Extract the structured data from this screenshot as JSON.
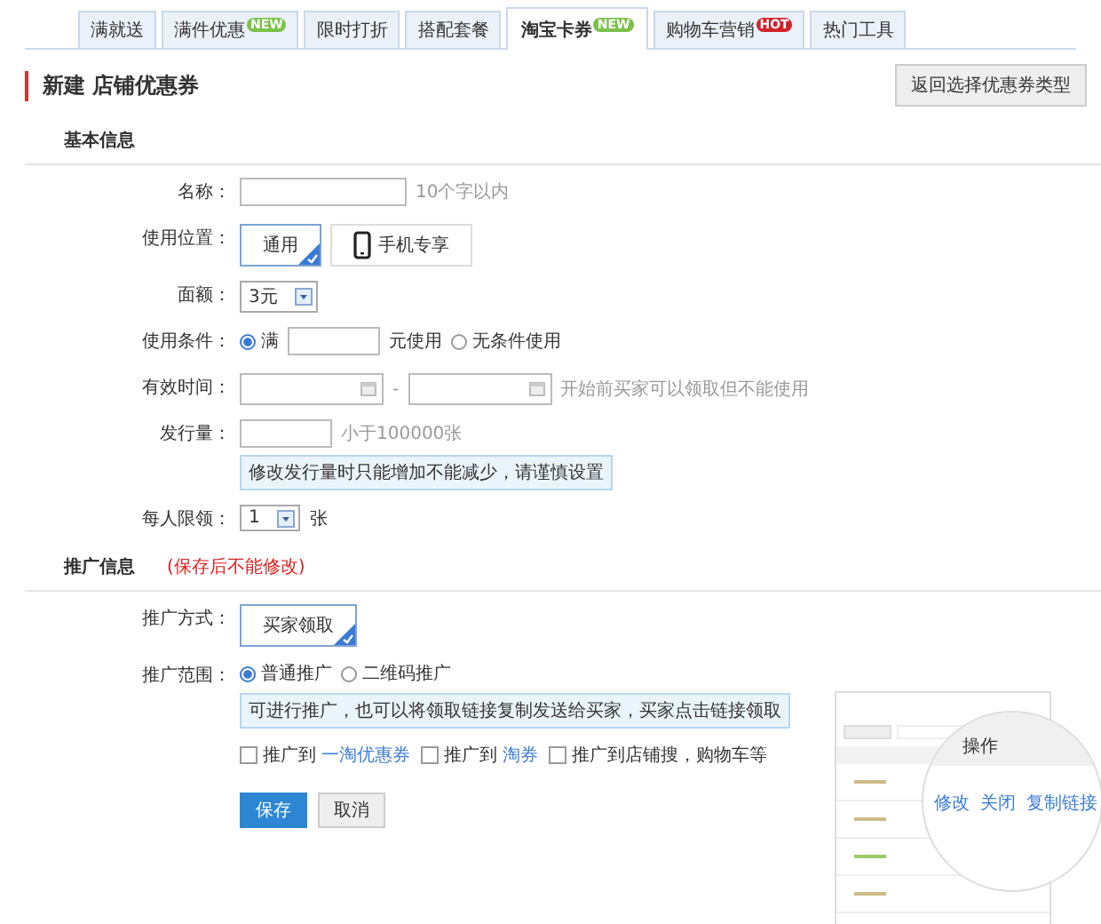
{
  "tabs": [
    {
      "label": "满就送",
      "selected": false
    },
    {
      "label": "满件优惠",
      "selected": false,
      "badge": {
        "text": "NEW",
        "kind": "new"
      }
    },
    {
      "label": "限时打折",
      "selected": false
    },
    {
      "label": "搭配套餐",
      "selected": false
    },
    {
      "label": "淘宝卡券",
      "selected": true,
      "badge": {
        "text": "NEW",
        "kind": "new"
      }
    },
    {
      "label": "购物车营销",
      "selected": false,
      "badge": {
        "text": "HOT",
        "kind": "hot"
      }
    },
    {
      "label": "热门工具",
      "selected": false
    }
  ],
  "page_title": "新建 店铺优惠券",
  "back_button": "返回选择优惠券类型",
  "basic_section": {
    "title": "基本信息",
    "rows": [
      {
        "kind": "text",
        "label": "名称：",
        "hint": "10个字以内"
      },
      {
        "kind": "choices",
        "label": "使用位置：",
        "options": [
          {
            "label": "通用",
            "selected": true,
            "kind": "plain"
          },
          {
            "label": "手机专享",
            "selected": false,
            "kind": "mobile"
          }
        ]
      },
      {
        "kind": "select",
        "label": "面额：",
        "value": "3元"
      },
      {
        "kind": "condition",
        "label": "使用条件：",
        "options": [
          {
            "label": "满",
            "selected": true
          },
          {
            "label": "无条件使用",
            "selected": false
          }
        ],
        "suffix": "元使用"
      },
      {
        "kind": "daterange",
        "label": "有效时间：",
        "separator": "-",
        "hint": "开始前买家可以领取但不能使用"
      },
      {
        "kind": "text",
        "label": "发行量：",
        "hint": "小于100000张",
        "note": "修改发行量时只能增加不能减少，请谨慎设置"
      },
      {
        "kind": "select",
        "label": "每人限领：",
        "value": "1",
        "suffix": "张"
      }
    ]
  },
  "promo_section": {
    "title": "推广信息",
    "warning": "(保存后不能修改)",
    "rows": [
      {
        "kind": "choices",
        "label": "推广方式：",
        "options": [
          {
            "label": "买家领取",
            "selected": true
          }
        ]
      },
      {
        "kind": "radios",
        "label": "推广范围：",
        "options": [
          {
            "label": "普通推广",
            "selected": true
          },
          {
            "label": "二维码推广",
            "selected": false
          }
        ],
        "note": "可进行推广，也可以将领取链接复制发送给买家，买家点击链接领取"
      },
      {
        "kind": "checks",
        "options": [
          {
            "label": "推广到",
            "link": "一淘优惠券",
            "checked": false
          },
          {
            "label": "推广到",
            "link": "淘券",
            "checked": false
          },
          {
            "label": "推广到店铺搜，购物车等",
            "checked": false
          }
        ]
      }
    ]
  },
  "buttons": [
    {
      "label": "保存",
      "kind": "primary"
    },
    {
      "label": "取消",
      "kind": "default"
    }
  ],
  "preview": {
    "header": "操作",
    "links": [
      "修改",
      "关闭",
      "复制链接"
    ]
  }
}
